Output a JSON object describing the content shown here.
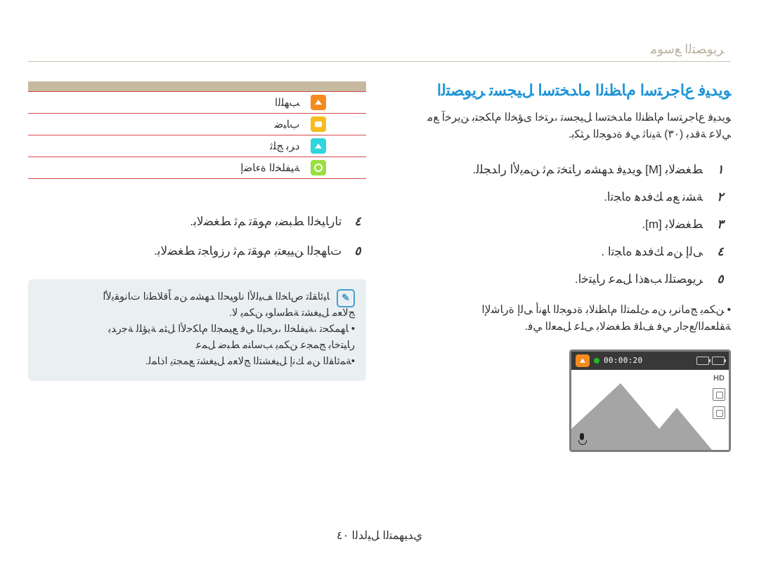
{
  "header": {
    "section": "ﺮﻳﻮﺼﺘﻟا ﻊﺳﻮﻣ"
  },
  "left": {
    "modes": [
      {
        "label": "ﺐﻬﻠﻟا",
        "icon": "orange"
      },
      {
        "label": "بﺎﺒﺿ",
        "icon": "yellow"
      },
      {
        "label": "دﺮﺑ ﺞﻠﺛ",
        "icon": "cyan"
      },
      {
        "label": "ﺔﻴﻔﻠﺨﻟا ةءﺎﺿإ",
        "icon": "green"
      }
    ],
    "steps": [
      {
        "n": "٤",
        "text": ".تارﺎﻴﺨﻟا ﻂﺒﻀﺑ مﻮﻘﺗ ﻢﺛ   ﻂﻐﻀﻟﺎﺑ"
      },
      {
        "n": "٥",
        "text": ".تﺎﻬﺠﻟا ﻦﻴﻴﻌﺘﺑ مﻮﻘﺗ ﻢﺛ رزوﺎﺠﺗ   ﻂﻐﻀﻟﺎﺑ"
      }
    ],
    "note": {
      "line1": "ًﺎﻴﺋﺎﻘﻠﺗ صﺎﺨﻟا ﻒﻴﻟﻷا ناﻮﻴﺤﻟا ﺪﻬﺸﻣ ﻦﻣ ﺎًﻗﻼﻄﻧا تﺎﻧﻮﻘﻳﻷا",
      "line2": ".ﺞﻟﺎﻌﻣ ﻞﻴﻐﺸﺗ ﺔﻄﺳاﻮﺑ ﻦﻜﻤﻳ ﻻ",
      "line3": "ﺎﻬﻤﻜﺤﺗ ،ﺔﻴﻔﻠﺨﻟا ،ﺮﺤﺒﻟا ﻲﻓ ﻊﻴﻤﺠﻟا مﺎﻜﺣﻷا ﻞﺜﻣ ﺔﻳﺆﻠﻟ ﺔﺟرﺪﺑ •",
      "line4": "رﺎﻴﺘﺧﺎﺑ ﺞﻤﺠﻋ    ﻦﻜﻤﻳ ﺐﺳﺎﻨﻣ ﻂﺒﺿ ﻞﻤﻋ",
      "line5": ".ﺔﻤﺋﺎﻘﻟا ﻦﻣ ﻚﻧإ ﻞﻴﻐﺸﺘﻟا ﺞﻟﺎﻌﻣ ﻞﻴﻐﺸﺗ ﻊﻤﺠﺘﻳ اذﺎﻤﻟ•"
    }
  },
  "right": {
    "title": "ﻮﻳﺪﻴﻓ عﺎﺟﺮﺘﺳا ﻡﺎﻈﻨﻟا ماﺪﺨﺘﺳا ﻞﻴﺠﺴﺗ ﺮﻳﻮﺼﺘﻟا",
    "intro1": "ﻮﻳﺪﻴﻓ عﺎﺟﺮﺘﺳا ﻡﺎﻈﻨﻟا ماﺪﺨﺘﺳا ﻞﻴﺠﺴﺗ ،ﺮﺘﺧا ىﺆﺨﻟا مﺎﻜﺠﺘﺑ ﻦﻳﺮﺧﺁ ﻊﻣ",
    "intro2": ".ﻲﻟﺎﻋ ﺔﻗﺪﺑ (٣٠) ﺔﻴﻧﺎﺛ ﻲﻓ ةدﻮﺠﻟا ﺮﺜﻜﺑ",
    "steps": [
      {
        "n": "١",
        "text": ".ﻮﻳﺪﻴﻓ ﺪﻬﺸﻣ رﺎﺘﺨﺗ ﻢﺛ ﻦﻤﻳﻷا راﺪﺠﻠﻟ [M] ﻂﻐﻀﻟﺎﺑ"
      },
      {
        "n": "٢",
        "text": ".ﺔﺸﻧ ﻊﻣ ﻚﻓﺪﻫ هﺎﺠﺗا"
      },
      {
        "n": "٣",
        "text": ".[m] ﻂﻐﻀﻟﺎﺑ"
      },
      {
        "n": "٤",
        "text": ".       ﻰﻟإ        ﻦﻣ ﻚﻓﺪﻫ هﺎﺠﺗا"
      },
      {
        "n": "٥",
        "text": ".ﺮﻳﻮﺼﺘﻠﻟ ﺐﻫذا ﻞﻤﻋ رﺎﻴﺘﺧا"
      }
    ],
    "sub1": "ﻦﻜﻤﻳ ﺞﻣﺎﻧﺮﺑ ﻦﻣ ﺊﻠﻤﺘﻟا ﻡﺎﻈﻨﻟﺎﺑ ةدﻮﺠﻟا ﺎﻬﻧأ ﻰﻟإ ةرﺎﺷﻹا •",
    "sub2": ".ﺔﻘﻠﻌﻤﻟا/ﻊﺟار ﻲﻓ ﻒﻠﻗ ﻂﻐﻀﻟﺎﺑ ﻰﻠﻋ ﻞﻤﻌﻟا ﻲﻓ",
    "camera": {
      "time": "00:00:20",
      "badge": "HD"
    }
  },
  "footer": "يﺪﻴﻬﻤﺘﻟا ﻞﻴﻟﺪﻟا ٤٠"
}
